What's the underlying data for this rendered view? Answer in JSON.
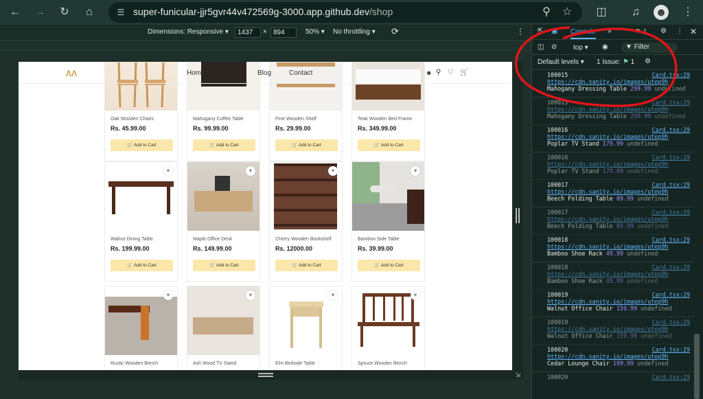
{
  "browser": {
    "url_host": "super-funicular-jjr5gvr44v472569g-3000.app.github.dev",
    "url_path": "/shop"
  },
  "devbar": {
    "dimensions": "Dimensions: Responsive",
    "width": "1437",
    "x": "×",
    "height": "894",
    "zoom": "50%",
    "throttle": "No throttling"
  },
  "nav": {
    "home": "Home",
    "blog": "Blog",
    "contact": "Contact"
  },
  "products": [
    {
      "name": "Oak Wooden Chairs",
      "price": "Rs. 45.99.00",
      "cta": "Add to Cart"
    },
    {
      "name": "Mahogany Coffee Table",
      "price": "Rs. 99.99.00",
      "cta": "Add to Cart"
    },
    {
      "name": "Pine Wooden Shelf",
      "price": "Rs. 29.99.00",
      "cta": "Add to Cart"
    },
    {
      "name": "Teak Wooden Bed Frame",
      "price": "Rs. 349.99.00",
      "cta": "Add to Cart"
    },
    {
      "name": "Walnut Dining Table",
      "price": "Rs. 199.99.00",
      "cta": "Add to Cart"
    },
    {
      "name": "Maple Office Desk",
      "price": "Rs. 149.99.00",
      "cta": "Add to Cart"
    },
    {
      "name": "Cherry Wooden Bookshelf",
      "price": "Rs. 12000.00",
      "cta": "Add to Cart"
    },
    {
      "name": "Bamboo Side Table",
      "price": "Rs. 39.99.00",
      "cta": "Add to Cart"
    },
    {
      "name": "Rustic Wooden Bench",
      "price": "",
      "cta": ""
    },
    {
      "name": "Ash Wood TV Stand",
      "price": "",
      "cta": ""
    },
    {
      "name": "Elm Bedside Table",
      "price": "",
      "cta": ""
    },
    {
      "name": "Spruce Wooden Bench",
      "price": "",
      "cta": ""
    }
  ],
  "devtools": {
    "tab": "Console",
    "issues_badge": "1",
    "context": "top",
    "filter": "Filter",
    "levels": "Default levels",
    "issues": "1 Issue:",
    "issues_count": "1"
  },
  "logs": [
    {
      "id": "100015",
      "src": "Card.tsx:29",
      "url": "https://cdn.sanity.io/images/utep9h",
      "name": "Mahogany Dressing Table",
      "num": "299.99",
      "und": "undefined",
      "dim": false
    },
    {
      "id": "100015",
      "src": "Card.tsx:29",
      "url": "https://cdn.sanity.io/images/utep9h",
      "name": "Mahogany Dressing Table",
      "num": "299.99",
      "und": "undefined",
      "dim": true
    },
    {
      "id": "100016",
      "src": "Card.tsx:29",
      "url": "https://cdn.sanity.io/images/utep9h",
      "name": "Poplar TV Stand",
      "num": "179.99",
      "und": "undefined",
      "dim": false
    },
    {
      "id": "100016",
      "src": "Card.tsx:29",
      "url": "https://cdn.sanity.io/images/utep9h",
      "name": "Poplar TV Stand",
      "num": "179.99",
      "und": "undefined",
      "dim": true
    },
    {
      "id": "100017",
      "src": "Card.tsx:29",
      "url": "https://cdn.sanity.io/images/utep9h",
      "name": "Beech Folding Table",
      "num": "89.99",
      "und": "undefined",
      "dim": false
    },
    {
      "id": "100017",
      "src": "Card.tsx:29",
      "url": "https://cdn.sanity.io/images/utep9h",
      "name": "Beech Folding Table",
      "num": "89.99",
      "und": "undefined",
      "dim": true
    },
    {
      "id": "100018",
      "src": "Card.tsx:29",
      "url": "https://cdn.sanity.io/images/utep9h",
      "name": "Bamboo Shoe Rack",
      "num": "49.99",
      "und": "undefined",
      "dim": false
    },
    {
      "id": "100018",
      "src": "Card.tsx:29",
      "url": "https://cdn.sanity.io/images/utep9h",
      "name": "Bamboo Shoe Rack",
      "num": "49.99",
      "und": "undefined",
      "dim": true
    },
    {
      "id": "100019",
      "src": "Card.tsx:29",
      "url": "https://cdn.sanity.io/images/utep9h",
      "name": "Walnut Office Chair",
      "num": "159.99",
      "und": "undefined",
      "dim": false
    },
    {
      "id": "100019",
      "src": "Card.tsx:29",
      "url": "https://cdn.sanity.io/images/utep9h",
      "name": "Walnut Office Chair",
      "num": "159.99",
      "und": "undefined",
      "dim": true
    },
    {
      "id": "100020",
      "src": "Card.tsx:29",
      "url": "https://cdn.sanity.io/images/utep9h",
      "name": "Cedar Lounge Chair",
      "num": "199.99",
      "und": "undefined",
      "dim": false
    },
    {
      "id": "100020",
      "src": "Card.tsx:29",
      "url": "",
      "name": "",
      "num": "",
      "und": "",
      "dim": true
    }
  ],
  "colors": {
    "accent": "#fbe7a9",
    "annotation": "#e0151a",
    "link": "#64b8ff",
    "number": "#a78bff"
  }
}
